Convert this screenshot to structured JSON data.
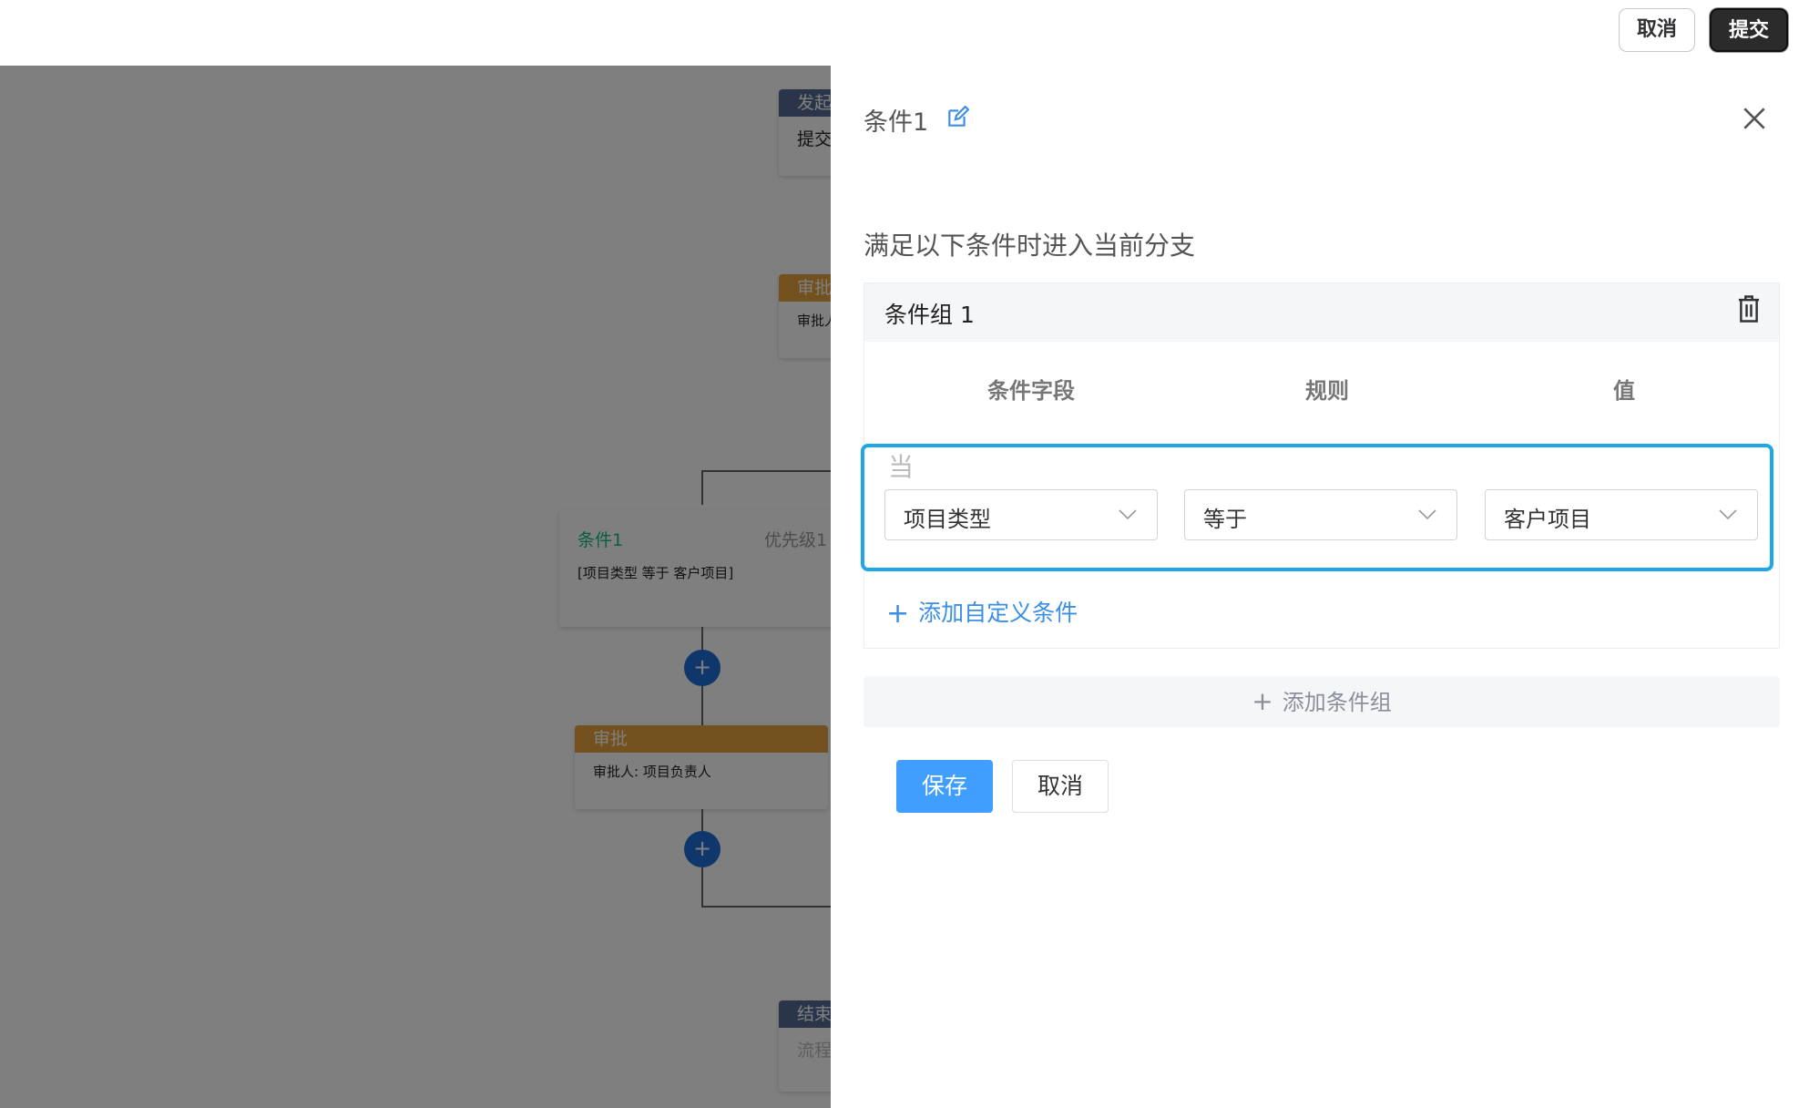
{
  "topbar": {
    "cancel_label": "取消",
    "submit_label": "提交"
  },
  "canvas": {
    "start_node": {
      "header": "发起",
      "body": "提交"
    },
    "approval_node_top": {
      "header": "审批",
      "body": "审批人"
    },
    "condition_node": {
      "title": "条件1",
      "priority": "优先级1",
      "rule": "[项目类型 等于 客户项目]"
    },
    "approval_node": {
      "header": "审批",
      "body": "审批人: 项目负责人"
    },
    "end_node": {
      "header": "结束",
      "body": "流程"
    },
    "add_symbol": "+"
  },
  "drawer": {
    "title": "条件1",
    "subtitle": "满足以下条件时进入当前分支",
    "group": {
      "title": "条件组 1",
      "columns": [
        "条件字段",
        "规则",
        "值"
      ],
      "when_label": "当",
      "condition": {
        "field": "项目类型",
        "rule": "等于",
        "value": "客户项目"
      },
      "add_custom_label": "添加自定义条件"
    },
    "add_group_label": "添加条件组",
    "save_label": "保存",
    "cancel_label": "取消"
  },
  "colors": {
    "accent": "#409eff",
    "highlight": "#1fa7e8",
    "approval": "#e6a23c",
    "start": "#576a95"
  }
}
